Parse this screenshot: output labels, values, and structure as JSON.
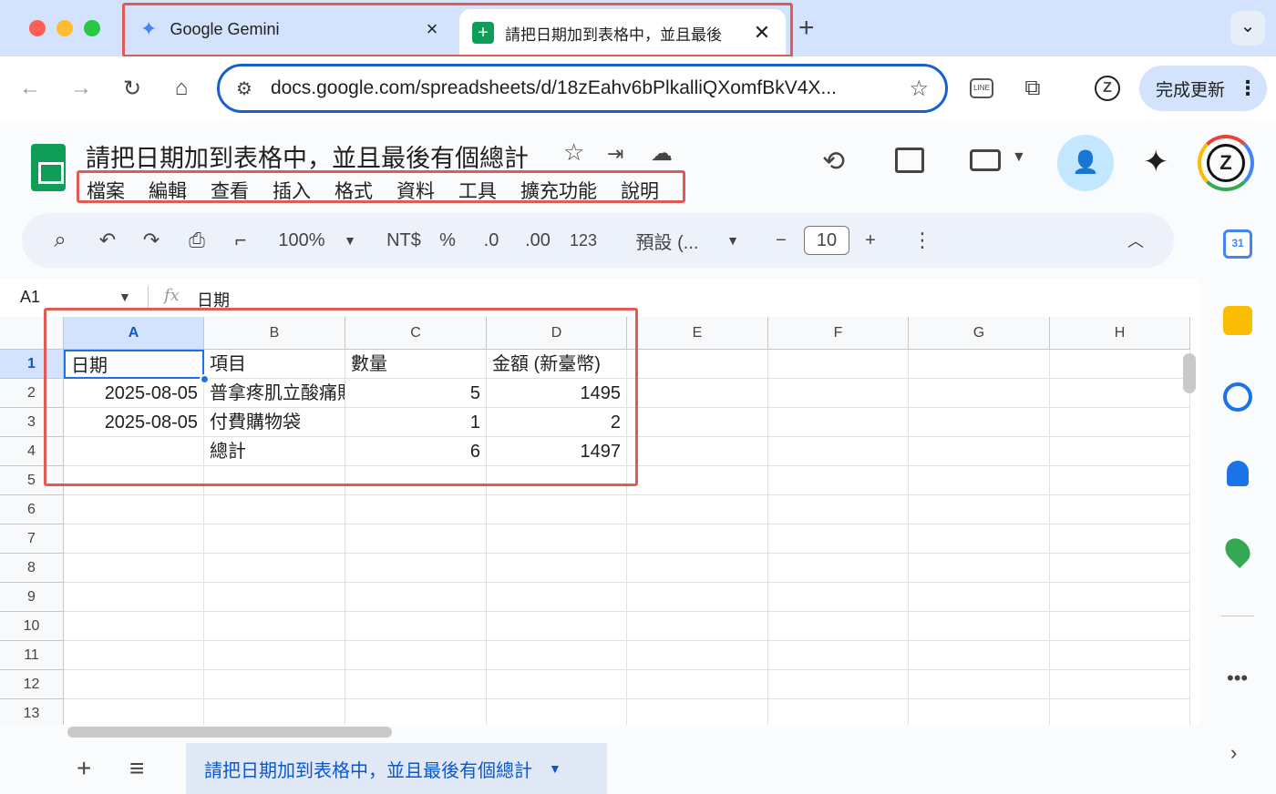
{
  "browser": {
    "tabs": [
      {
        "title": "Google Gemini",
        "active": false
      },
      {
        "title": "請把日期加到表格中，並且最後",
        "active": true
      }
    ],
    "new_tab": "+",
    "url": "docs.google.com/spreadsheets/d/18zEahv6bPlkalliQXomfBkV4X...",
    "update_label": "完成更新",
    "dropdown": "⌄"
  },
  "doc": {
    "title": "請把日期加到表格中，並且最後有個總計",
    "menu": [
      "檔案",
      "編輯",
      "查看",
      "插入",
      "格式",
      "資料",
      "工具",
      "擴充功能",
      "說明"
    ]
  },
  "toolbar": {
    "zoom": "100%",
    "currency": "NT$",
    "percent": "%",
    "dec_less": ".0",
    "dec_more": ".00",
    "number_format": "123",
    "font": "預設 (...",
    "font_size": "10",
    "minus": "−",
    "plus": "+"
  },
  "formula_bar": {
    "cell_ref": "A1",
    "fx": "fx",
    "value": "日期"
  },
  "grid": {
    "columns": [
      "A",
      "B",
      "C",
      "D",
      "E",
      "F",
      "G",
      "H"
    ],
    "rows": [
      "1",
      "2",
      "3",
      "4",
      "5",
      "6",
      "7",
      "8",
      "9",
      "10",
      "11",
      "12",
      "13"
    ],
    "cells": {
      "A1": "日期",
      "B1": "項目",
      "C1": "數量",
      "D1": "金額 (新臺幣)",
      "A2": "2025-08-05",
      "B2": "普拿疼肌立酸痛貼",
      "C2": "5",
      "D2": "1495",
      "A3": "2025-08-05",
      "B3": "付費購物袋",
      "C3": "1",
      "D3": "2",
      "B4": "總計",
      "C4": "6",
      "D4": "1497"
    }
  },
  "sheet_tab": {
    "name": "請把日期加到表格中，並且最後有個總計",
    "add": "+",
    "list": "≡"
  },
  "colors": {
    "accent": "#0b57d0",
    "highlight": "#e05a56",
    "sheets_green": "#0f9d58"
  }
}
